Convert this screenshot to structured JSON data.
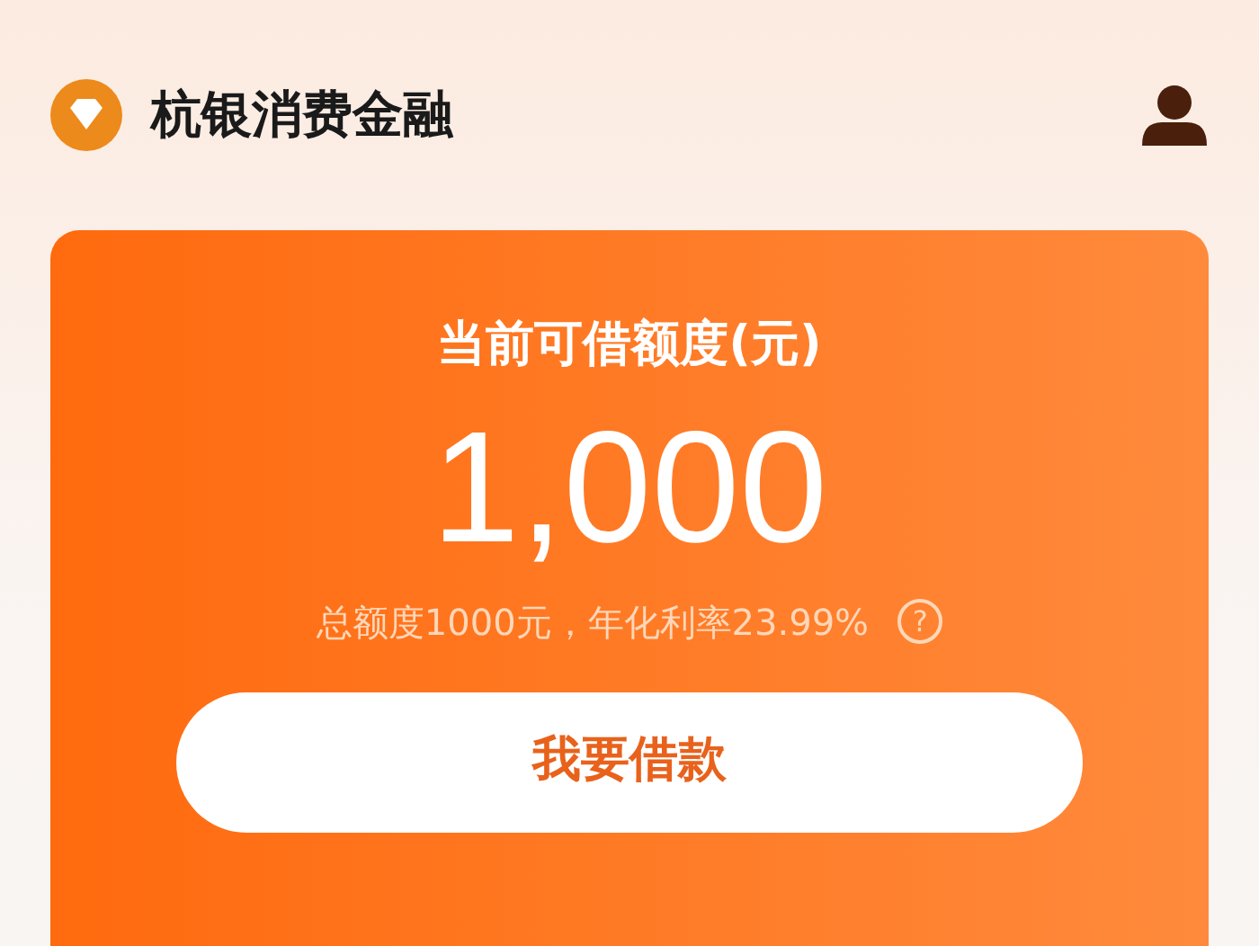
{
  "header": {
    "title": "杭银消费金融"
  },
  "credit_card": {
    "label": "当前可借额度(元)",
    "amount": "1,000",
    "note": "总额度1000元，年化利率23.99%",
    "help": "?",
    "button": "我要借款"
  }
}
